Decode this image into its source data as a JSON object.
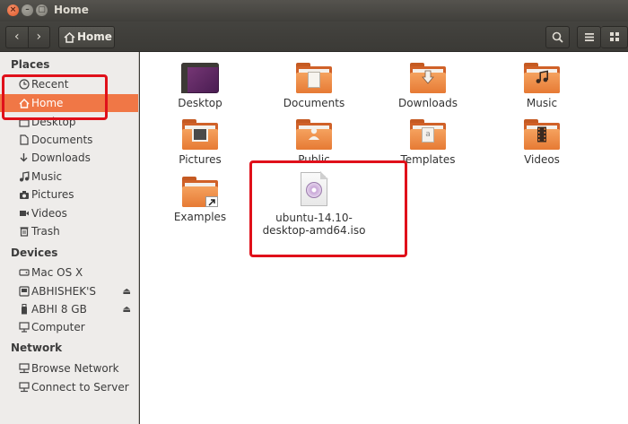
{
  "window": {
    "title": "Home"
  },
  "toolbar": {
    "back_label": "‹",
    "forward_label": "›",
    "path_label": "Home",
    "search_icon": "search-icon",
    "list_icon": "list-view-icon",
    "grid_icon": "grid-view-icon"
  },
  "sidebar": {
    "places_header": "Places",
    "places": [
      {
        "label": "Recent",
        "icon": "clock-icon"
      },
      {
        "label": "Home",
        "icon": "home-icon",
        "active": true
      },
      {
        "label": "Desktop",
        "icon": "desktop-icon"
      },
      {
        "label": "Documents",
        "icon": "document-icon"
      },
      {
        "label": "Downloads",
        "icon": "download-icon"
      },
      {
        "label": "Music",
        "icon": "music-icon"
      },
      {
        "label": "Pictures",
        "icon": "camera-icon"
      },
      {
        "label": "Videos",
        "icon": "video-icon"
      },
      {
        "label": "Trash",
        "icon": "trash-icon"
      }
    ],
    "devices_header": "Devices",
    "devices": [
      {
        "label": "Mac OS X",
        "icon": "drive-icon"
      },
      {
        "label": "ABHISHEK'S",
        "icon": "drive-icon",
        "eject": true
      },
      {
        "label": "ABHI 8 GB",
        "icon": "usb-icon",
        "eject": true
      },
      {
        "label": "Computer",
        "icon": "computer-icon"
      }
    ],
    "network_header": "Network",
    "network": [
      {
        "label": "Browse Network",
        "icon": "network-icon"
      },
      {
        "label": "Connect to Server",
        "icon": "server-icon"
      }
    ]
  },
  "files": [
    {
      "name": "Desktop",
      "icon": "desktop-folder-icon"
    },
    {
      "name": "Documents",
      "icon": "documents-folder-icon"
    },
    {
      "name": "Downloads",
      "icon": "downloads-folder-icon"
    },
    {
      "name": "Music",
      "icon": "music-folder-icon"
    },
    {
      "name": "Pictures",
      "icon": "pictures-folder-icon"
    },
    {
      "name": "Public",
      "icon": "public-folder-icon"
    },
    {
      "name": "Templates",
      "icon": "templates-folder-icon"
    },
    {
      "name": "Videos",
      "icon": "videos-folder-icon"
    },
    {
      "name": "Examples",
      "icon": "examples-folder-icon"
    },
    {
      "name_line1": "ubuntu-14.10-",
      "name_line2": "desktop-amd64.iso",
      "icon": "iso-file-icon"
    }
  ],
  "colors": {
    "accent": "#f07746",
    "highlight": "#e0101a"
  }
}
